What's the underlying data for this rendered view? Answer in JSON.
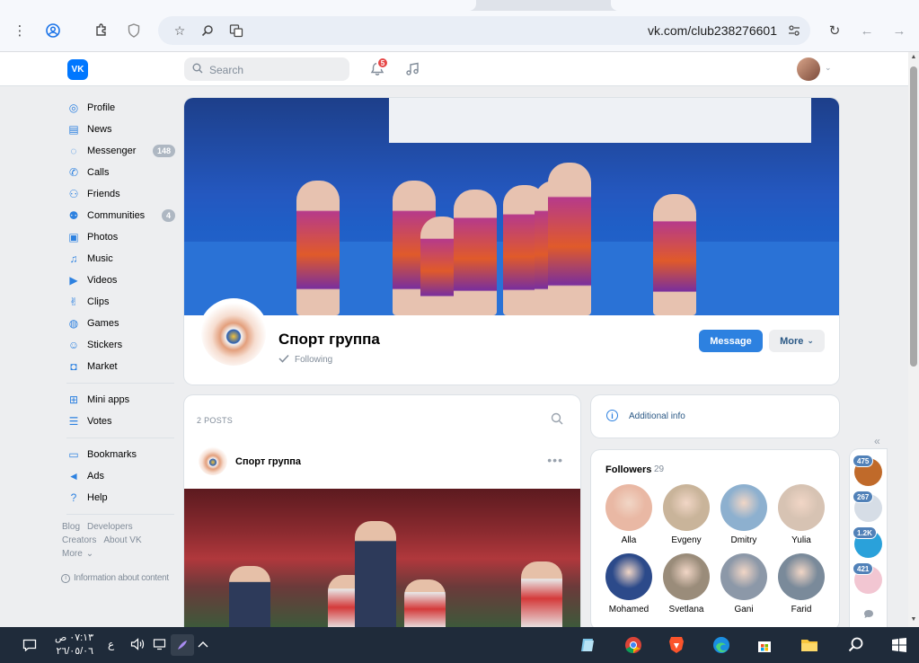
{
  "browser": {
    "url": "vk.com/club238276601"
  },
  "header": {
    "logo_text": "VK",
    "search_placeholder": "Search",
    "notifications_count": "5"
  },
  "nav": {
    "items": [
      {
        "label": "Profile",
        "icon": "user-circle-icon"
      },
      {
        "label": "News",
        "icon": "news-icon"
      },
      {
        "label": "Messenger",
        "icon": "message-icon",
        "badge": "148"
      },
      {
        "label": "Calls",
        "icon": "phone-icon"
      },
      {
        "label": "Friends",
        "icon": "friends-icon"
      },
      {
        "label": "Communities",
        "icon": "communities-icon",
        "badge": "4"
      },
      {
        "label": "Photos",
        "icon": "photo-icon"
      },
      {
        "label": "Music",
        "icon": "music-icon"
      },
      {
        "label": "Videos",
        "icon": "video-icon"
      },
      {
        "label": "Clips",
        "icon": "clips-icon"
      },
      {
        "label": "Games",
        "icon": "gamepad-icon"
      },
      {
        "label": "Stickers",
        "icon": "smile-icon"
      },
      {
        "label": "Market",
        "icon": "bag-icon"
      }
    ],
    "items2": [
      {
        "label": "Mini apps",
        "icon": "apps-icon"
      },
      {
        "label": "Votes",
        "icon": "votes-icon"
      }
    ],
    "items3": [
      {
        "label": "Bookmarks",
        "icon": "bookmark-icon"
      },
      {
        "label": "Ads",
        "icon": "megaphone-icon"
      },
      {
        "label": "Help",
        "icon": "help-icon"
      }
    ],
    "footer_links": {
      "blog": "Blog",
      "developers": "Developers",
      "creators": "Creators",
      "about": "About VK",
      "more": "More"
    },
    "info_link": "Information about content"
  },
  "group": {
    "name": "Спорт группа",
    "following_label": "Following",
    "message_button": "Message",
    "more_button": "More"
  },
  "wall": {
    "posts_count_label": "2 POSTS",
    "post_author": "Спорт группа"
  },
  "right": {
    "additional_info": "Additional info",
    "followers_title": "Followers",
    "followers_count": "29",
    "followers": [
      {
        "name": "Alla",
        "color": "#e9b8a4"
      },
      {
        "name": "Evgeny",
        "color": "#c9b49a"
      },
      {
        "name": "Dmitry",
        "color": "#8db0cf"
      },
      {
        "name": "Yulia",
        "color": "#d7c3b3"
      },
      {
        "name": "Mohamed",
        "color": "#2c4a8a"
      },
      {
        "name": "Svetlana",
        "color": "#9a8c7a"
      },
      {
        "name": "Gani",
        "color": "#8c98a8"
      },
      {
        "name": "Farid",
        "color": "#7a8a9a"
      }
    ]
  },
  "chats": [
    {
      "badge": "475",
      "color": "#c06a2a"
    },
    {
      "badge": "267",
      "color": "#d6dde6"
    },
    {
      "badge": "1.2K",
      "color": "#2aa1da"
    },
    {
      "badge": "421",
      "color": "#f2c6d2"
    }
  ],
  "taskbar": {
    "time": "٠٧:١٣ ص",
    "date": "٢٦/٠٥/٠٦",
    "lang": "ع"
  },
  "colors": {
    "vk_blue": "#0077ff",
    "accent": "#2d81e0",
    "page_bg": "#edeef0"
  }
}
